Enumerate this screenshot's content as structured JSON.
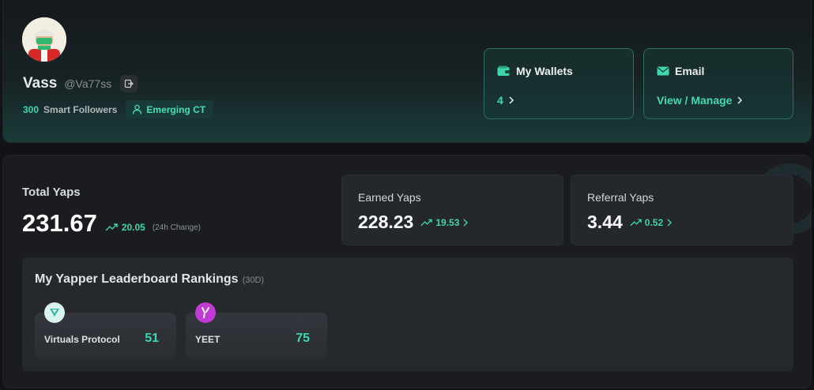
{
  "colors": {
    "accent": "#3fd6ac",
    "background": "#111316",
    "card": "#24272c"
  },
  "profile": {
    "name": "Vass",
    "handle": "@Va77ss",
    "followers_count": "300",
    "followers_label": "Smart Followers",
    "badge_label": "Emerging CT",
    "icons": {
      "logout": "logout-icon",
      "badge": "user-icon"
    }
  },
  "wallets": {
    "title": "My Wallets",
    "value": "4",
    "icon": "wallet-icon"
  },
  "email": {
    "title": "Email",
    "value": "View / Manage",
    "icon": "mail-icon"
  },
  "stats": {
    "total": {
      "label": "Total Yaps",
      "value": "231.67",
      "change": "20.05",
      "change_label": "(24h Change)"
    },
    "earned": {
      "label": "Earned Yaps",
      "value": "228.23",
      "change": "19.53"
    },
    "referral": {
      "label": "Referral Yaps",
      "value": "3.44",
      "change": "0.52"
    }
  },
  "rankings": {
    "title": "My Yapper Leaderboard Rankings",
    "period": "(30D)",
    "items": [
      {
        "name": "Virtuals Protocol",
        "rank": "51",
        "icon": "virtuals-logo-icon"
      },
      {
        "name": "YEET",
        "rank": "75",
        "icon": "yeet-logo-icon"
      }
    ]
  }
}
